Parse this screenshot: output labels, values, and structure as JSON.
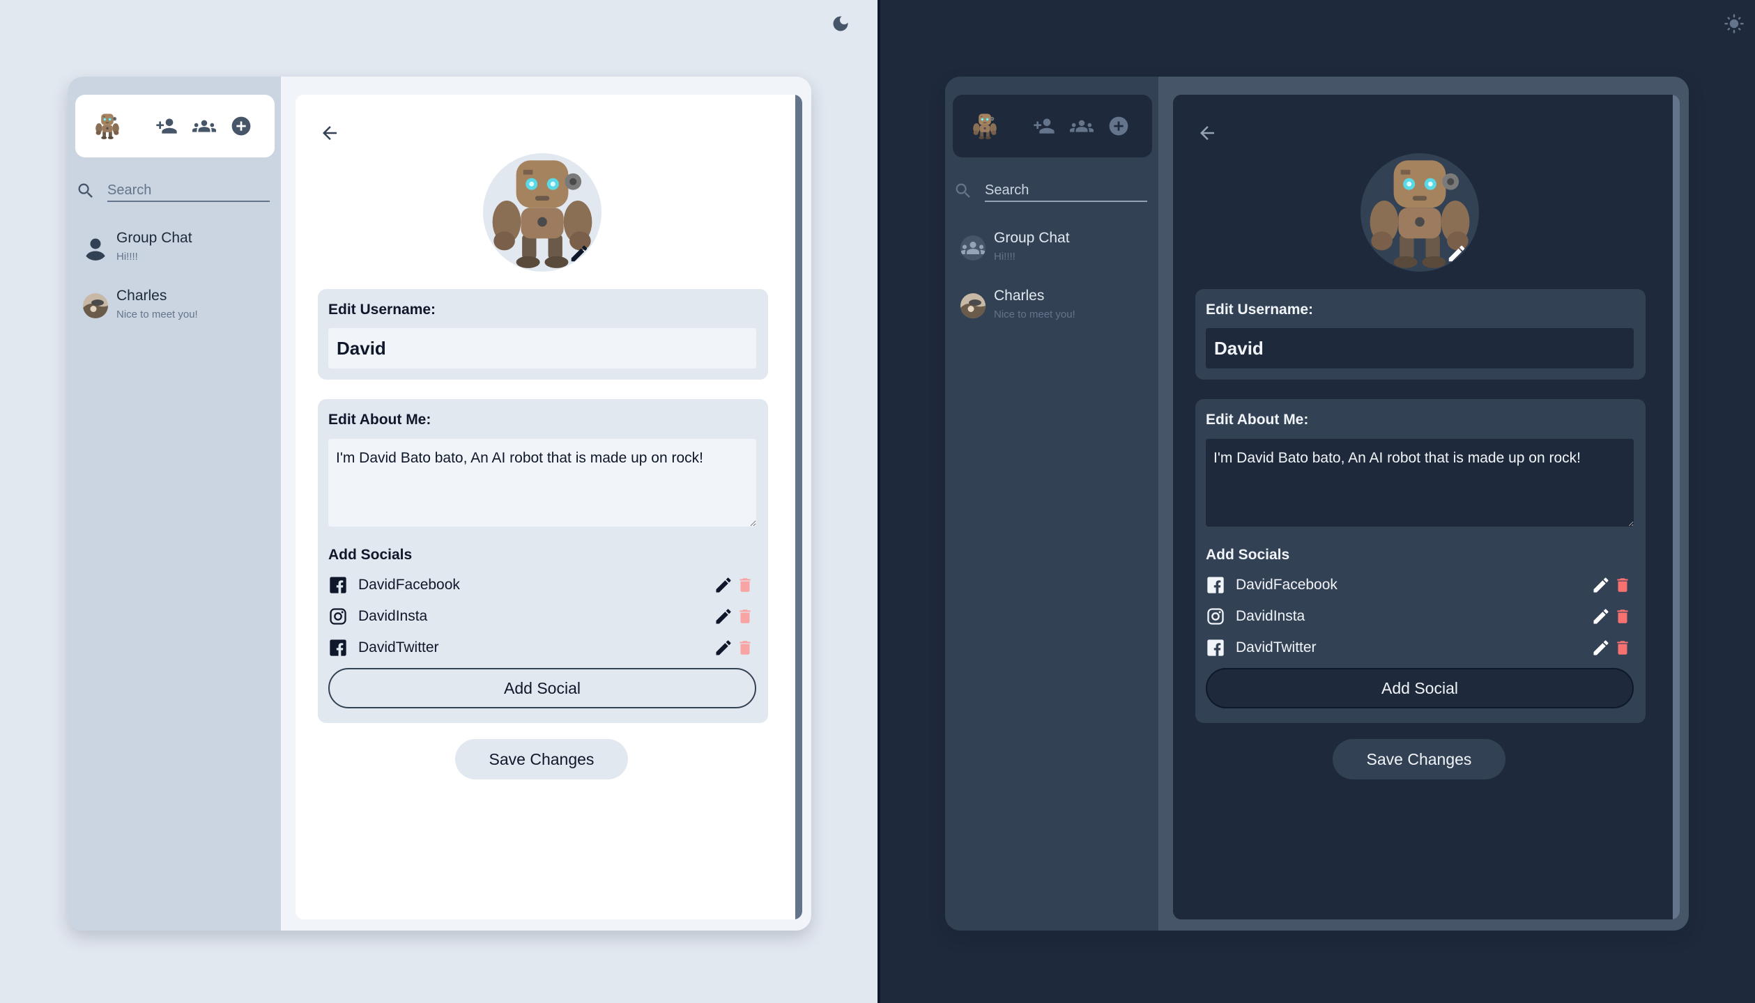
{
  "themes": {
    "light": {
      "toggle_icon": "moon-icon"
    },
    "dark": {
      "toggle_icon": "sun-icon"
    }
  },
  "sidebar": {
    "search_placeholder": "Search",
    "chats": [
      {
        "name": "Group Chat",
        "last_message": "Hi!!!!"
      },
      {
        "name": "Charles",
        "last_message": "Nice to meet you!"
      }
    ],
    "toolbar_icons": [
      "add-friend-icon",
      "group-icon",
      "add-circle-icon"
    ]
  },
  "profile": {
    "username_label": "Edit Username:",
    "username_value": "David",
    "about_label": "Edit About Me:",
    "about_value": "I'm David Bato bato, An AI robot that is made up on rock!",
    "socials_label": "Add Socials",
    "socials": [
      {
        "name": "DavidFacebook",
        "icon": "facebook-icon"
      },
      {
        "name": "DavidInsta",
        "icon": "instagram-icon"
      },
      {
        "name": "DavidTwitter",
        "icon": "facebook-icon"
      }
    ],
    "add_social_label": "Add Social",
    "save_label": "Save Changes"
  },
  "colors": {
    "light_bg": "#e2e8f0",
    "dark_bg": "#1e293b",
    "delete_light": "#f8a4a4",
    "delete_dark": "#f87171"
  }
}
